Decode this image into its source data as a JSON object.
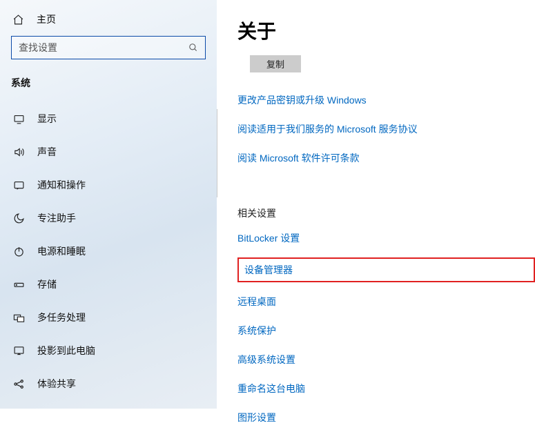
{
  "sidebar": {
    "home": "主页",
    "search_placeholder": "查找设置",
    "section": "系统",
    "items": [
      {
        "label": "显示"
      },
      {
        "label": "声音"
      },
      {
        "label": "通知和操作"
      },
      {
        "label": "专注助手"
      },
      {
        "label": "电源和睡眠"
      },
      {
        "label": "存储"
      },
      {
        "label": "多任务处理"
      },
      {
        "label": "投影到此电脑"
      },
      {
        "label": "体验共享"
      }
    ]
  },
  "main": {
    "title": "关于",
    "copy_label": "复制",
    "top_links": [
      "更改产品密钥或升级 Windows",
      "阅读适用于我们服务的 Microsoft 服务协议",
      "阅读 Microsoft 软件许可条款"
    ],
    "related_header": "相关设置",
    "related_links": [
      "BitLocker 设置",
      "设备管理器",
      "远程桌面",
      "系统保护",
      "高级系统设置",
      "重命名这台电脑",
      "图形设置"
    ],
    "highlight_index": 1
  }
}
